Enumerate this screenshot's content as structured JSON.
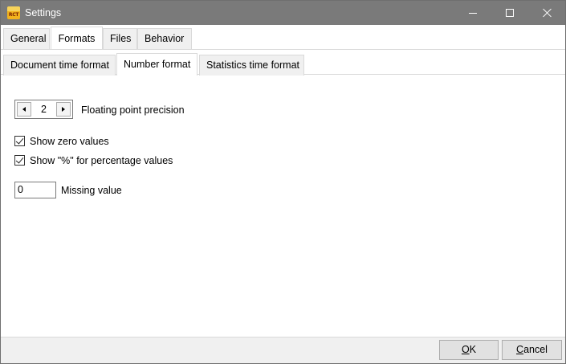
{
  "window": {
    "title": "Settings",
    "app_icon": "rct-app-icon",
    "app_icon_text": "RCT"
  },
  "outer_tabs": [
    {
      "label": "General",
      "active": false
    },
    {
      "label": "Formats",
      "active": true
    },
    {
      "label": "Files",
      "active": false
    },
    {
      "label": "Behavior",
      "active": false
    }
  ],
  "inner_tabs": [
    {
      "label": "Document time format",
      "active": false
    },
    {
      "label": "Number format",
      "active": true
    },
    {
      "label": "Statistics time format",
      "active": false
    }
  ],
  "precision": {
    "value": "2",
    "label": "Floating point precision"
  },
  "show_zero": {
    "checked": true,
    "label": "Show zero values"
  },
  "show_percent": {
    "checked": true,
    "label": "Show \"%\" for percentage values"
  },
  "missing": {
    "value": "0",
    "label": "Missing value"
  },
  "buttons": {
    "ok_mnemonic": "O",
    "ok_rest": "K",
    "cancel_mnemonic": "C",
    "cancel_rest": "ancel"
  },
  "colors": {
    "titlebar": "#7a7a7a",
    "accent": "#f2b31d"
  }
}
